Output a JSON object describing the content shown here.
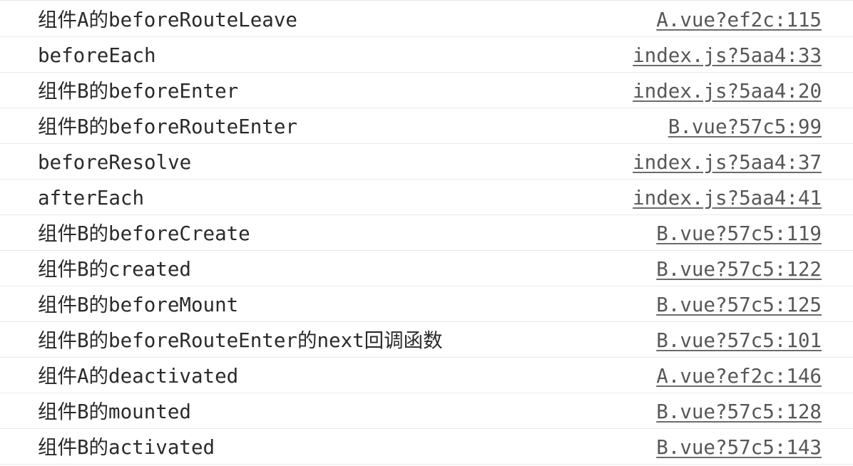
{
  "console": {
    "messages": [
      {
        "text": "组件A的beforeRouteLeave",
        "source": "A.vue?ef2c:115"
      },
      {
        "text": "beforeEach",
        "source": "index.js?5aa4:33"
      },
      {
        "text": "组件B的beforeEnter",
        "source": "index.js?5aa4:20"
      },
      {
        "text": "组件B的beforeRouteEnter",
        "source": "B.vue?57c5:99"
      },
      {
        "text": "beforeResolve",
        "source": "index.js?5aa4:37"
      },
      {
        "text": "afterEach",
        "source": "index.js?5aa4:41"
      },
      {
        "text": "组件B的beforeCreate",
        "source": "B.vue?57c5:119"
      },
      {
        "text": "组件B的created",
        "source": "B.vue?57c5:122"
      },
      {
        "text": "组件B的beforeMount",
        "source": "B.vue?57c5:125"
      },
      {
        "text": "组件B的beforeRouteEnter的next回调函数",
        "source": "B.vue?57c5:101"
      },
      {
        "text": "组件A的deactivated",
        "source": "A.vue?ef2c:146"
      },
      {
        "text": "组件B的mounted",
        "source": "B.vue?57c5:128"
      },
      {
        "text": "组件B的activated",
        "source": "B.vue?57c5:143"
      }
    ]
  }
}
